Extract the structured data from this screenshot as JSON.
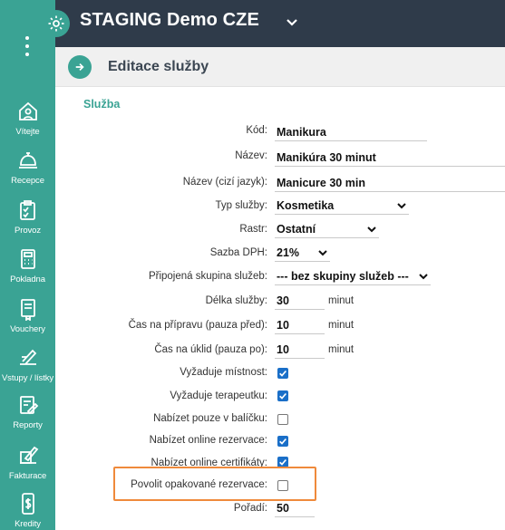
{
  "app": {
    "title": "STAGING Demo CZE"
  },
  "page": {
    "title": "Editace služby"
  },
  "sidebar": {
    "items": [
      {
        "label": "Vítejte",
        "icon": "home-icon"
      },
      {
        "label": "Recepce",
        "icon": "bell-icon"
      },
      {
        "label": "Provoz",
        "icon": "clipboard-icon"
      },
      {
        "label": "Pokladna",
        "icon": "cash-register-icon"
      },
      {
        "label": "Vouchery",
        "icon": "voucher-icon"
      },
      {
        "label": "Vstupy / lístky",
        "icon": "ticket-icon"
      },
      {
        "label": "Reporty",
        "icon": "report-icon"
      },
      {
        "label": "Fakturace",
        "icon": "invoice-icon"
      },
      {
        "label": "Kredity",
        "icon": "credit-icon"
      }
    ]
  },
  "form": {
    "section_title": "Služba",
    "fields": {
      "kod": {
        "label": "Kód:",
        "value": "Manikura"
      },
      "nazev": {
        "label": "Název:",
        "value": "Manikúra 30 minut"
      },
      "nazev_cizi": {
        "label": "Název (cizí jazyk):",
        "value": "Manicure 30 min"
      },
      "typ_sluzby": {
        "label": "Typ služby:",
        "value": "Kosmetika"
      },
      "rastr": {
        "label": "Rastr:",
        "value": "Ostatní"
      },
      "sazba_dph": {
        "label": "Sazba DPH:",
        "value": "21%"
      },
      "skupina": {
        "label": "Připojená skupina služeb:",
        "value": "--- bez skupiny služeb ---"
      },
      "delka": {
        "label": "Délka služby:",
        "value": "30",
        "unit": "minut"
      },
      "priprava": {
        "label": "Čas na přípravu (pauza před):",
        "value": "10",
        "unit": "minut"
      },
      "uklid": {
        "label": "Čas na úklid (pauza po):",
        "value": "10",
        "unit": "minut"
      },
      "mistnost": {
        "label": "Vyžaduje místnost:",
        "checked": true
      },
      "terapeutka": {
        "label": "Vyžaduje terapeutku:",
        "checked": true
      },
      "balicek": {
        "label": "Nabízet pouze v balíčku:",
        "checked": false
      },
      "online_rezervace": {
        "label": "Nabízet online rezervace:",
        "checked": true
      },
      "online_certifikaty": {
        "label": "Nabízet online certifikáty:",
        "checked": true
      },
      "opakovane": {
        "label": "Povolit opakované rezervace:",
        "checked": false
      },
      "poradi": {
        "label": "Pořadí:",
        "value": "50"
      }
    }
  },
  "colors": {
    "accent": "#3aa394",
    "header": "#2f3b4a",
    "checkbox": "#1a6fc8",
    "highlight": "#ef8a3b"
  }
}
